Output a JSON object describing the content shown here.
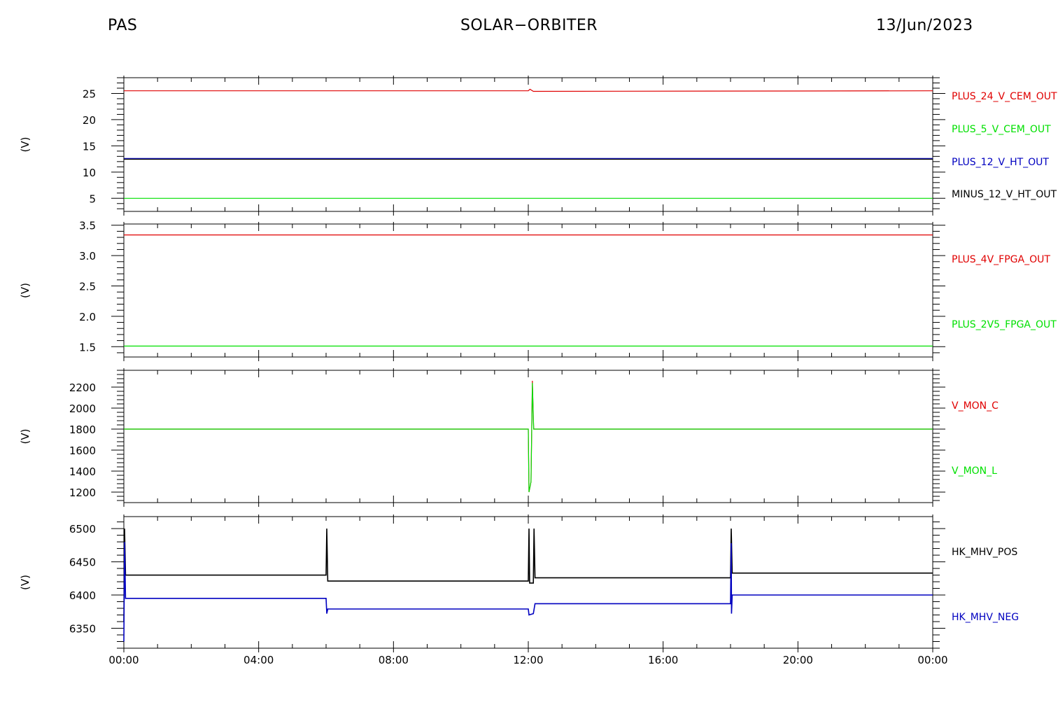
{
  "header": {
    "left": "PAS",
    "center": "SOLAR−ORBITER",
    "right": "13/Jun/2023"
  },
  "chart_data": [
    {
      "type": "line",
      "ylabel": "(V)",
      "ylim": [
        2.5,
        28
      ],
      "yticks": [
        5,
        10,
        15,
        20,
        25
      ],
      "x_ticks": [
        "00:00",
        "04:00",
        "08:00",
        "12:00",
        "16:00",
        "20:00",
        "00:00"
      ],
      "series": [
        {
          "name": "PLUS_24_V_CEM_OUT",
          "color": "#e00000",
          "points": [
            [
              0,
              25.5
            ],
            [
              12.0,
              25.5
            ],
            [
              12.05,
              25.8
            ],
            [
              12.15,
              25.4
            ],
            [
              24,
              25.5
            ]
          ]
        },
        {
          "name": "PLUS_5_V_CEM_OUT",
          "color": "#00e000",
          "points": [
            [
              0,
              5.0
            ],
            [
              24,
              5.0
            ]
          ]
        },
        {
          "name": "PLUS_12_V_HT_OUT",
          "color": "#0000c0",
          "points": [
            [
              0,
              12.6
            ],
            [
              24,
              12.6
            ]
          ]
        },
        {
          "name": "MINUS_12_V_HT_OUT",
          "color": "#000000",
          "points": [
            [
              0,
              12.45
            ],
            [
              24,
              12.45
            ]
          ]
        }
      ]
    },
    {
      "type": "line",
      "ylabel": "(V)",
      "ylim": [
        1.33,
        3.52
      ],
      "yticks": [
        1.5,
        2.0,
        2.5,
        3.0,
        3.5
      ],
      "ytick_labels": [
        "1.5",
        "2.0",
        "2.5",
        "3.0",
        "3.5"
      ],
      "x_ticks": [
        "00:00",
        "04:00",
        "08:00",
        "12:00",
        "16:00",
        "20:00",
        "00:00"
      ],
      "series": [
        {
          "name": "PLUS_4V_FPGA_OUT",
          "color": "#e00000",
          "points": [
            [
              0,
              3.34
            ],
            [
              24,
              3.34
            ]
          ]
        },
        {
          "name": "PLUS_2V5_FPGA_OUT",
          "color": "#00e000",
          "points": [
            [
              0,
              1.51
            ],
            [
              24,
              1.51
            ]
          ]
        }
      ]
    },
    {
      "type": "line",
      "ylabel": "(V)",
      "ylim": [
        1100,
        2360
      ],
      "yticks": [
        1200,
        1400,
        1600,
        1800,
        2000,
        2200
      ],
      "x_ticks": [
        "00:00",
        "04:00",
        "08:00",
        "12:00",
        "16:00",
        "20:00",
        "00:00"
      ],
      "series": [
        {
          "name": "V_MON_C",
          "color": "#e00000",
          "points": [
            [
              0,
              1800
            ],
            [
              12.0,
              1800
            ],
            [
              12.02,
              1200
            ],
            [
              12.08,
              1300
            ],
            [
              12.12,
              2260
            ],
            [
              12.16,
              1800
            ],
            [
              24,
              1800
            ]
          ]
        },
        {
          "name": "V_MON_L",
          "color": "#00e000",
          "points": [
            [
              0,
              1800
            ],
            [
              12.0,
              1800
            ],
            [
              12.02,
              1200
            ],
            [
              12.08,
              1300
            ],
            [
              12.12,
              2240
            ],
            [
              12.16,
              1800
            ],
            [
              24,
              1800
            ]
          ]
        }
      ]
    },
    {
      "type": "line",
      "ylabel": "(V)",
      "ylim": [
        6320,
        6518
      ],
      "yticks": [
        6350,
        6400,
        6450,
        6500
      ],
      "x_ticks": [
        "00:00",
        "04:00",
        "08:00",
        "12:00",
        "16:00",
        "20:00",
        "00:00"
      ],
      "series": [
        {
          "name": "HK_MHV_POS",
          "color": "#000000",
          "points": [
            [
              0,
              6360
            ],
            [
              0.02,
              6500
            ],
            [
              0.05,
              6430
            ],
            [
              6.0,
              6430
            ],
            [
              6.02,
              6500
            ],
            [
              6.05,
              6421
            ],
            [
              12.0,
              6421
            ],
            [
              12.02,
              6500
            ],
            [
              12.04,
              6418
            ],
            [
              12.15,
              6418
            ],
            [
              12.17,
              6500
            ],
            [
              12.2,
              6426
            ],
            [
              18.0,
              6426
            ],
            [
              18.02,
              6500
            ],
            [
              18.05,
              6433
            ],
            [
              24,
              6433
            ]
          ]
        },
        {
          "name": "HK_MHV_NEG",
          "color": "#0000c0",
          "points": [
            [
              0,
              6330
            ],
            [
              0.02,
              6480
            ],
            [
              0.05,
              6395
            ],
            [
              6.0,
              6395
            ],
            [
              6.02,
              6372
            ],
            [
              6.05,
              6379
            ],
            [
              12.0,
              6379
            ],
            [
              12.02,
              6370
            ],
            [
              12.15,
              6372
            ],
            [
              12.2,
              6387
            ],
            [
              18.0,
              6387
            ],
            [
              18.02,
              6478
            ],
            [
              18.03,
              6372
            ],
            [
              18.05,
              6400
            ],
            [
              24,
              6400
            ]
          ]
        }
      ]
    }
  ]
}
